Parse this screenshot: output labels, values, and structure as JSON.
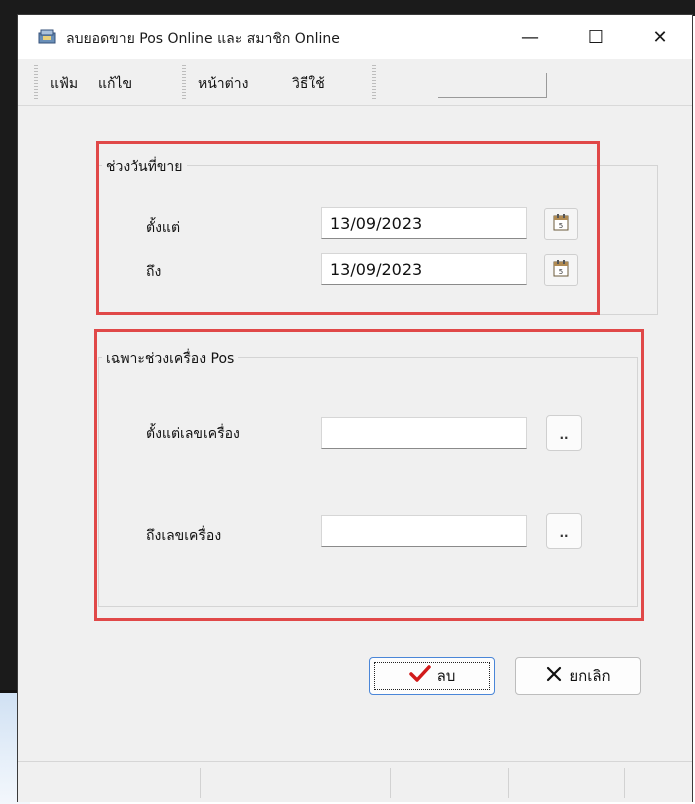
{
  "window": {
    "title": "ลบยอดขาย Pos Online และ สมาชิก Online",
    "minimize_glyph": "—",
    "maximize_glyph": "☐",
    "close_glyph": "✕"
  },
  "menu": {
    "items": [
      "แฟ้ม",
      "แก้ไข",
      "หน้าต่าง",
      "วิธีใช้"
    ]
  },
  "date_range": {
    "title": "ช่วงวันที่ขาย",
    "from_label": "ตั้งแต่",
    "from_value": "13/09/2023",
    "to_label": "ถึง",
    "to_value": "13/09/2023"
  },
  "pos_range": {
    "title": "เฉพาะช่วงเครื่อง Pos",
    "from_label": "ตั้งแต่เลขเครื่อง",
    "from_value": "",
    "to_label": "ถึงเลขเครื่อง",
    "to_value": "",
    "browse_label": ".."
  },
  "actions": {
    "delete_label": "ลบ",
    "cancel_label": "ยกเลิก"
  },
  "colors": {
    "highlight_box": "#e04848",
    "check_icon": "#d11a1a"
  },
  "icons": [
    "app-icon",
    "calendar-icon",
    "check-icon",
    "x-icon"
  ]
}
